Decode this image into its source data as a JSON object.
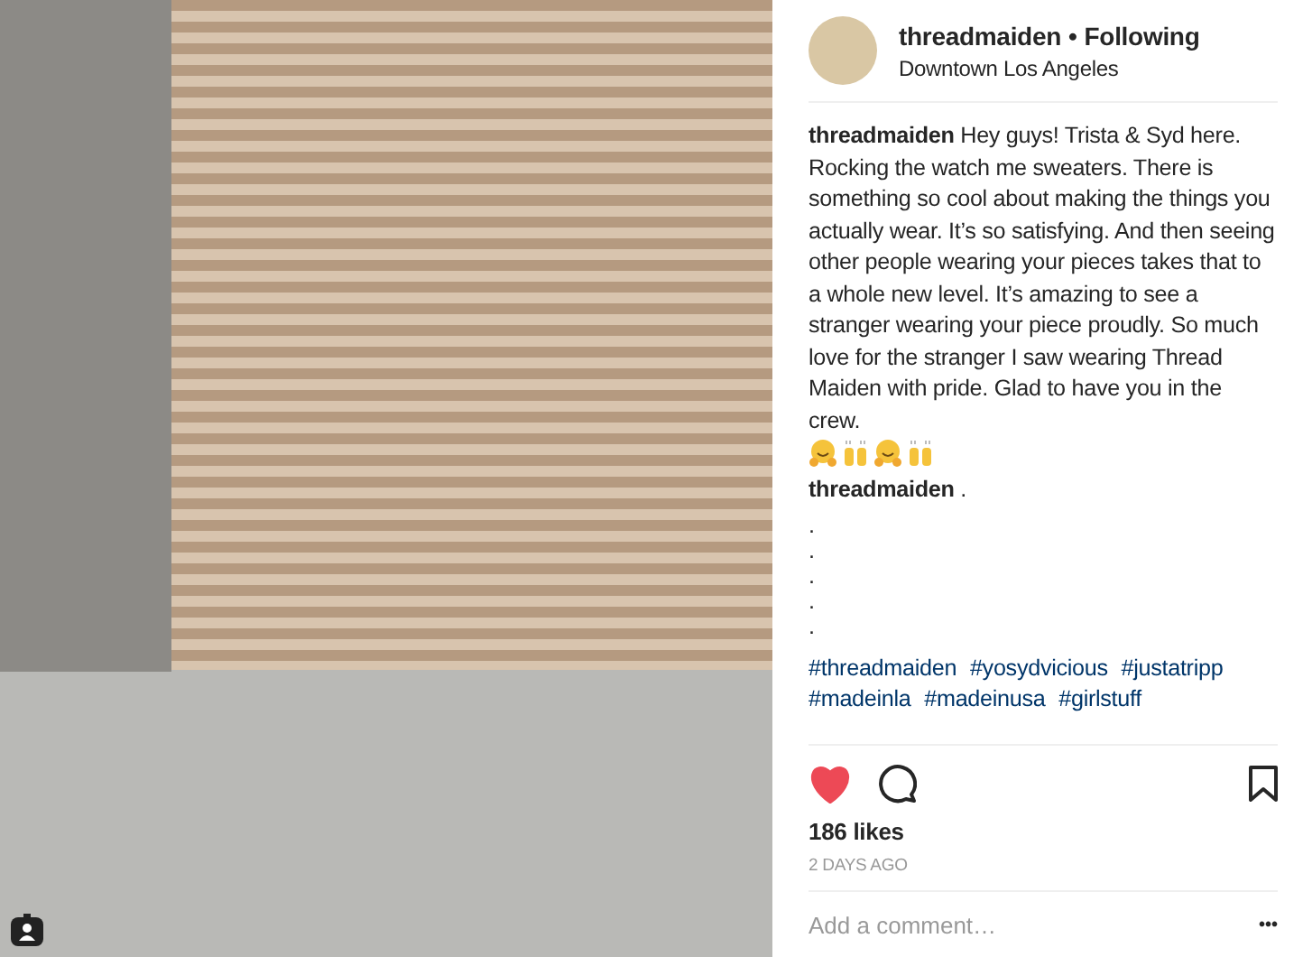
{
  "post": {
    "username": "threadmaiden",
    "separator": "•",
    "follow_status": "Following",
    "location": "Downtown Los Angeles",
    "caption": "**threadmaiden** Hey guys! Trista & Syd here. Rocking the watch me sweaters. There is something so cool about making the things you actually wear. It’s so satisfying. And then seeing other people wearing your pieces takes that to a whole new level. It’s amazing to see a stranger wearing your piece proudly. So much love for the stranger I saw wearing Thread Maiden with pride. Glad to have you in the crew.",
    "comment": "**threadmaiden** .",
    "comment_lines": [
      ".",
      ".",
      ".",
      ".",
      "."
    ],
    "hashtags": [
      "#threadmaiden",
      "#yosydvicious",
      "#justatripp",
      "#madeinla",
      "#madeinusa",
      "#girlstuff"
    ],
    "liked": true,
    "saved": false,
    "likes": "186 likes",
    "time": "2 DAYS AGO",
    "comment_placeholder": "Add a comment…",
    "more": "•••"
  }
}
